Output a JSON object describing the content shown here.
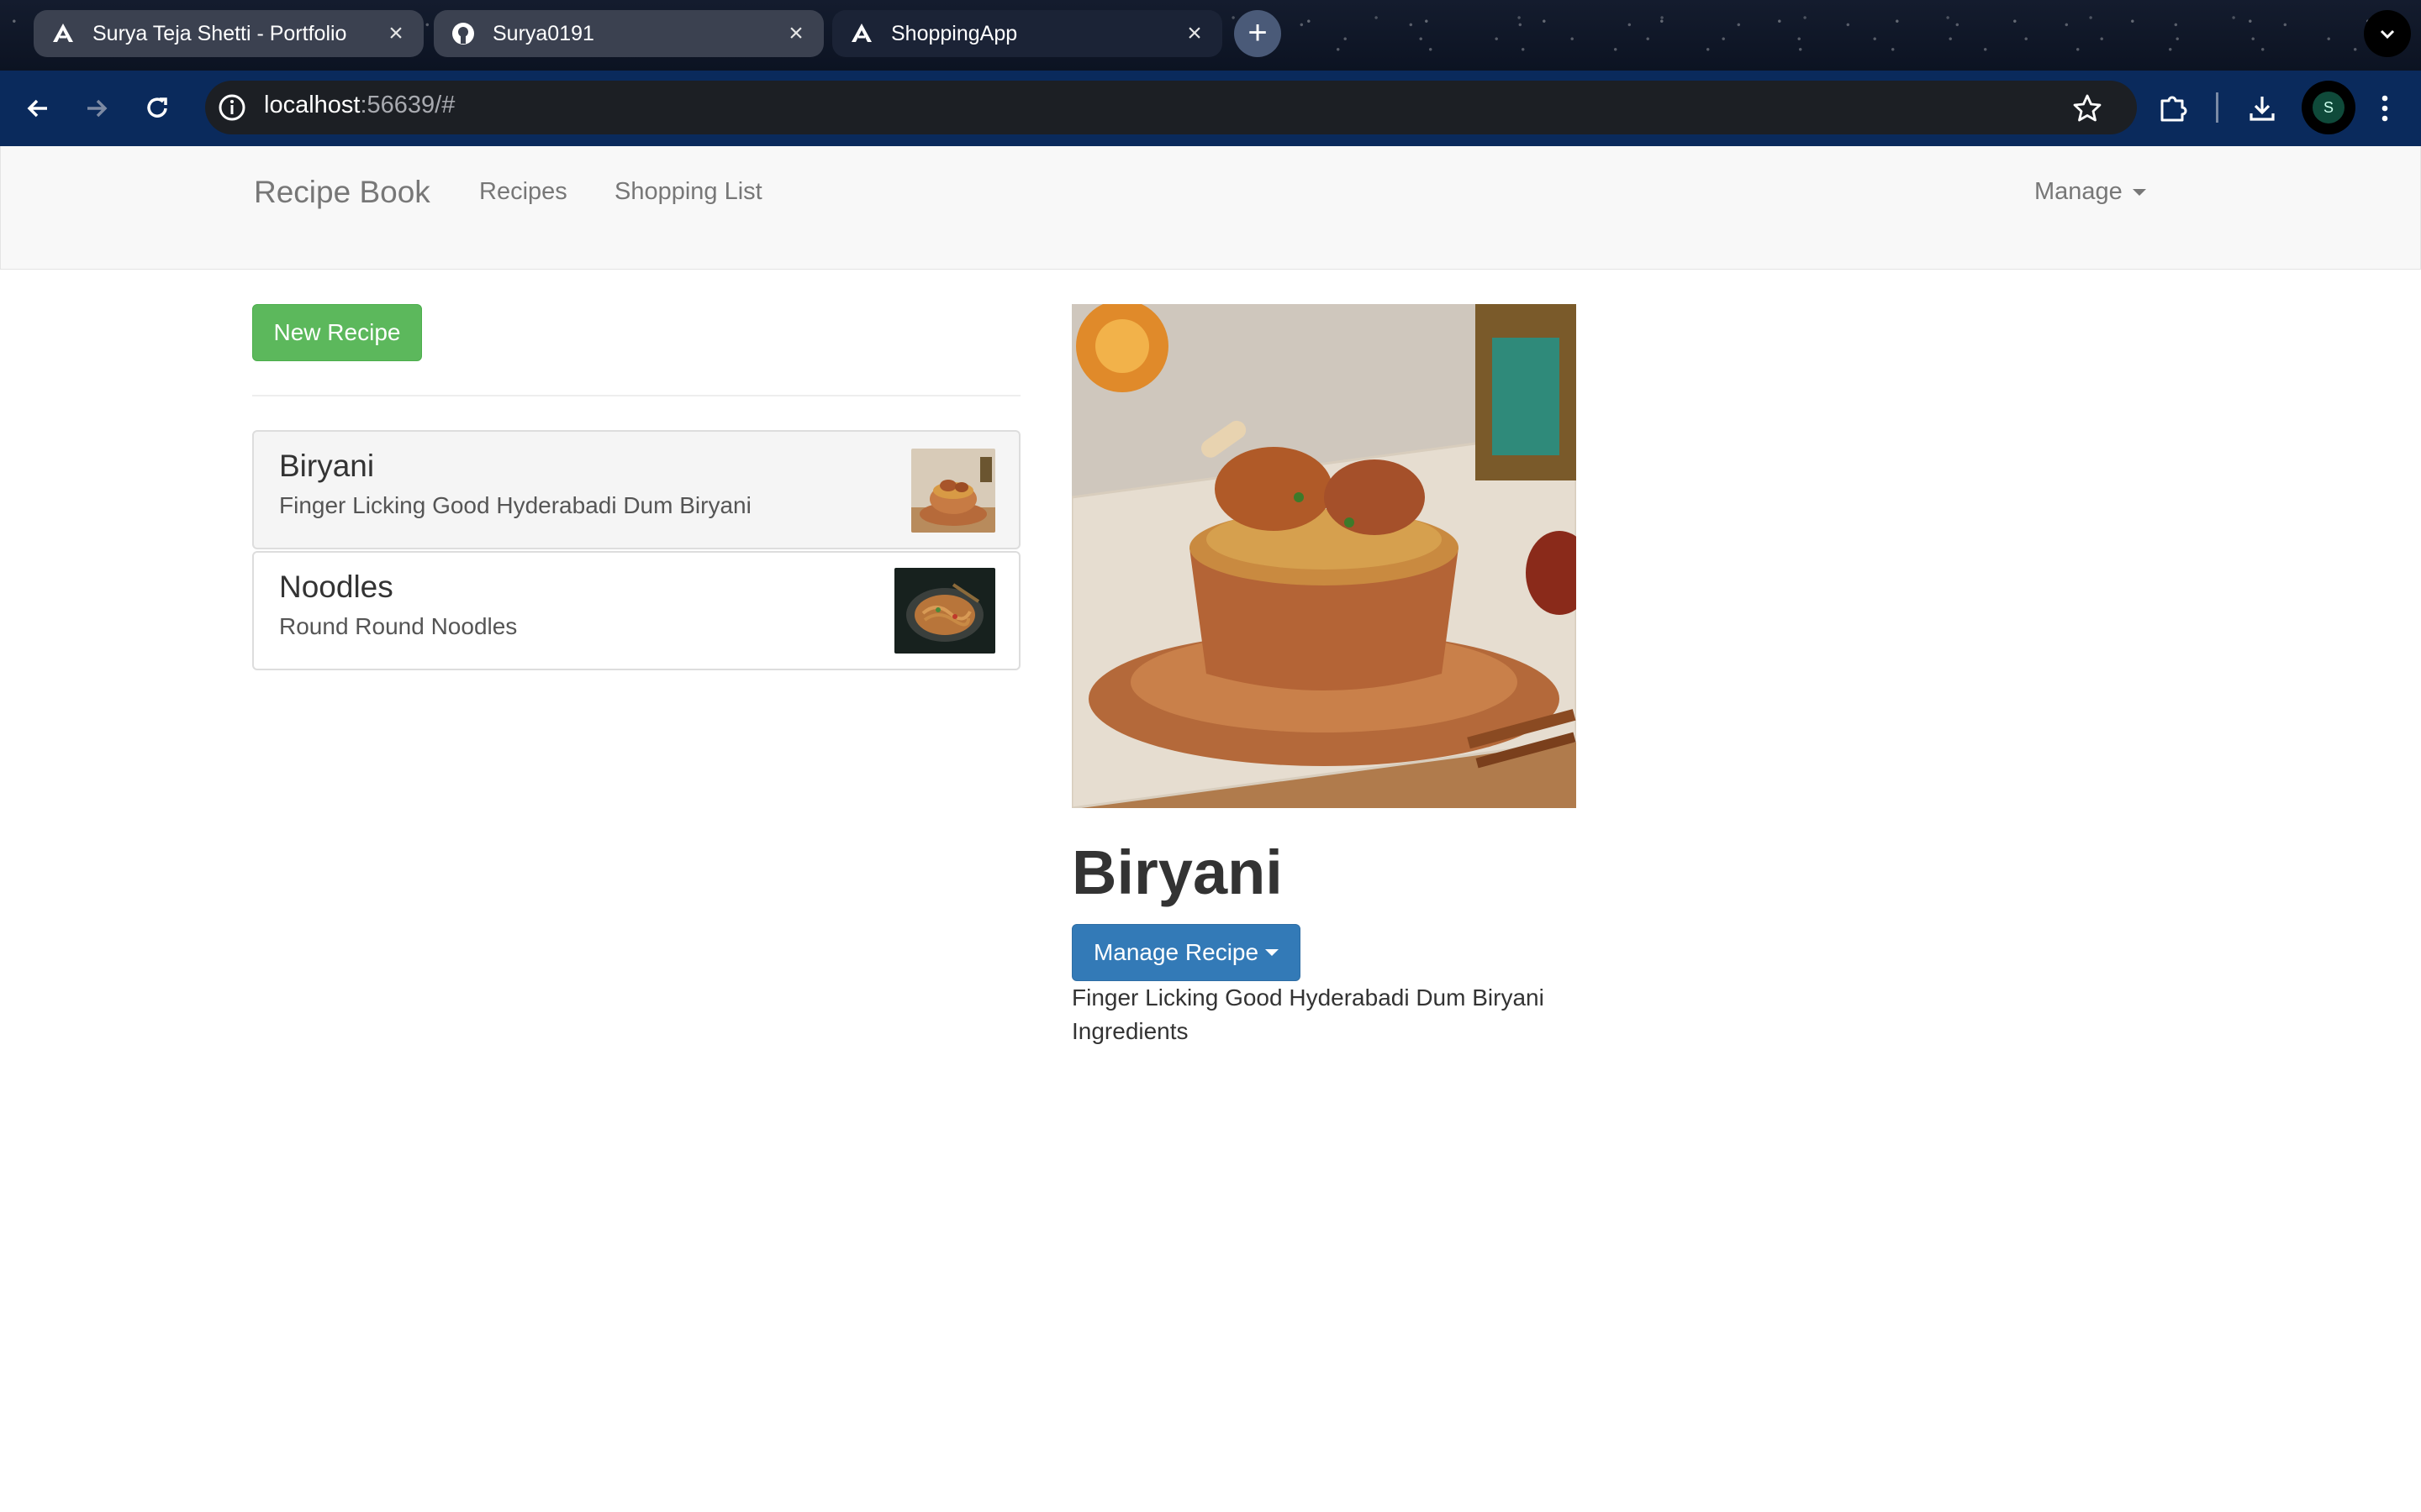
{
  "browser": {
    "tabs": [
      {
        "title": "Surya Teja Shetti - Portfolio",
        "favicon": "angular-icon",
        "active": false
      },
      {
        "title": "Surya0191",
        "favicon": "github-icon",
        "active": false
      },
      {
        "title": "ShoppingApp",
        "favicon": "angular-icon",
        "active": true
      }
    ],
    "new_tab_label": "+",
    "address": {
      "host": "localhost",
      "rest": ":56639/#"
    },
    "profile_initial": "S"
  },
  "navbar": {
    "brand": "Recipe Book",
    "links": [
      "Recipes",
      "Shopping List"
    ],
    "manage_label": "Manage"
  },
  "recipes": {
    "new_button_label": "New Recipe",
    "items": [
      {
        "name": "Biryani",
        "description": "Finger Licking Good Hyderabadi Dum Biryani",
        "active": true
      },
      {
        "name": "Noodles",
        "description": "Round Round Noodles",
        "active": false
      }
    ]
  },
  "detail": {
    "name": "Biryani",
    "manage_button_label": "Manage Recipe",
    "description": "Finger Licking Good Hyderabadi Dum Biryani",
    "ingredients_label": "Ingredients"
  },
  "colors": {
    "success": "#5cb85c",
    "primary": "#337ab7",
    "navbar_bg": "#f8f8f8",
    "browser_toolbar": "#0a2a5c"
  }
}
